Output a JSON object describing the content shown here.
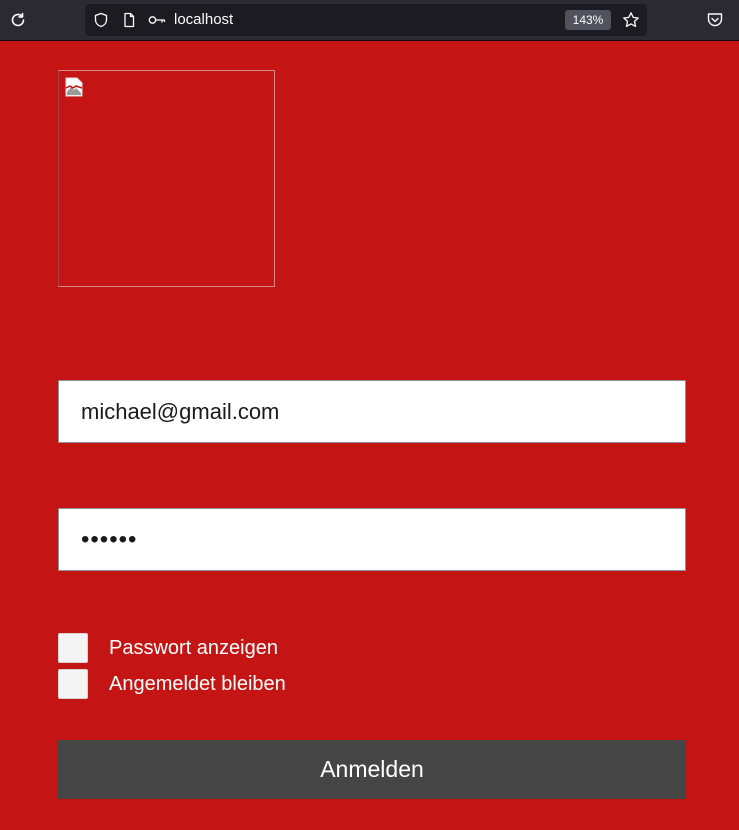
{
  "browser": {
    "url": "localhost",
    "zoom": "143%",
    "icons": [
      "reload-icon",
      "shield-icon",
      "page-icon",
      "key-icon",
      "star-icon",
      "pocket-icon"
    ]
  },
  "login": {
    "logo_icon": "broken-image-icon",
    "email_value": "michael@gmail.com",
    "password_value": "••••••",
    "show_password_label": "Passwort anzeigen",
    "stay_logged_in_label": "Angemeldet bleiben",
    "submit_label": "Anmelden"
  },
  "colors": {
    "page_background": "#c41414",
    "button_background": "#454545",
    "toolbar_background": "#2b2a33"
  }
}
